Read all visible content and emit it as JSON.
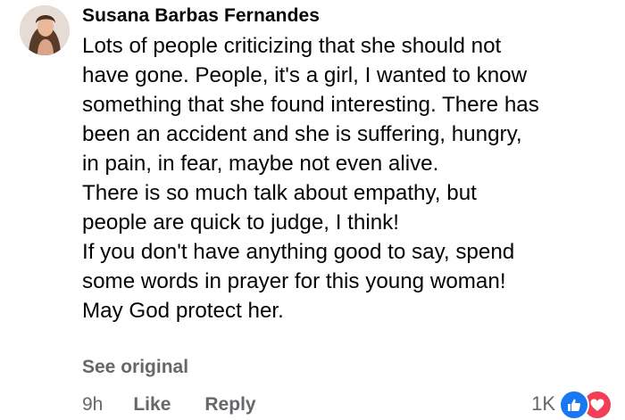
{
  "comment": {
    "author": "Susana Barbas Fernandes",
    "body_lines": [
      "Lots of people criticizing that she should not",
      "have gone. People, it's a girl, I wanted to know",
      "something that she found interesting. There has",
      "been an accident and she is suffering, hungry,",
      "in pain, in fear, maybe not even alive.",
      "There is so much talk about empathy, but",
      "people are quick to judge, I think!",
      "If you don't have anything good to say, spend",
      "some words in prayer for this young woman!",
      "May God protect her."
    ],
    "see_original_label": "See original",
    "timestamp": "9h",
    "like_label": "Like",
    "reply_label": "Reply",
    "reaction_count": "1K",
    "reaction_icons": [
      "like-icon",
      "love-icon"
    ]
  },
  "colors": {
    "text_primary": "#050505",
    "text_secondary": "#65676b",
    "like_blue": "#1877f2",
    "love_red": "#f33e58"
  }
}
